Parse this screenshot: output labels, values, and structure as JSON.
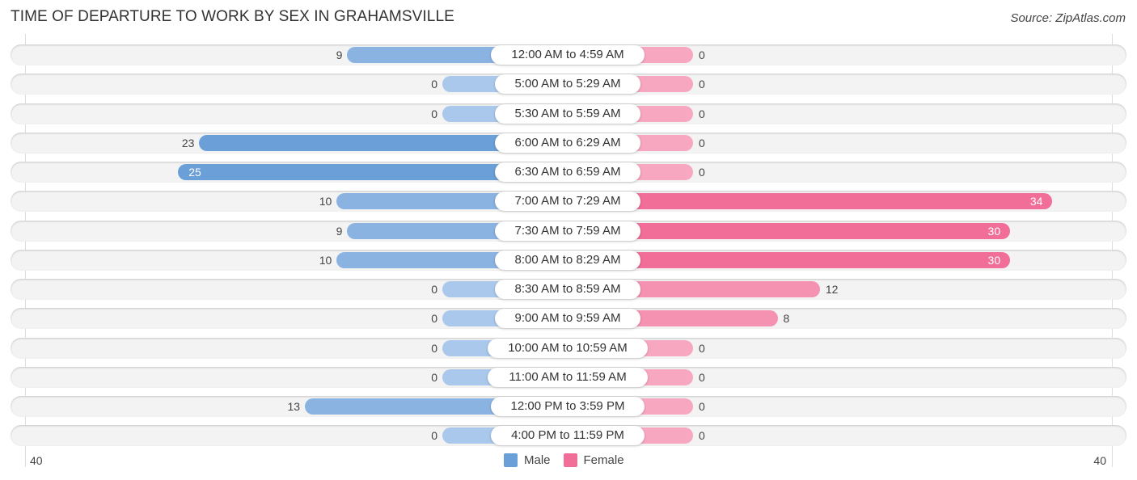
{
  "header": {
    "title": "TIME OF DEPARTURE TO WORK BY SEX IN GRAHAMSVILLE",
    "source": "Source: ZipAtlas.com"
  },
  "colors": {
    "male_strong": "#6a9fd8",
    "male_light": "#a9c8ec",
    "female_strong": "#f06e98",
    "female_light": "#f7a8c0"
  },
  "chart_data": {
    "type": "bar",
    "orientation": "horizontal-diverging",
    "title": "TIME OF DEPARTURE TO WORK BY SEX IN GRAHAMSVILLE",
    "categories": [
      "12:00 AM to 4:59 AM",
      "5:00 AM to 5:29 AM",
      "5:30 AM to 5:59 AM",
      "6:00 AM to 6:29 AM",
      "6:30 AM to 6:59 AM",
      "7:00 AM to 7:29 AM",
      "7:30 AM to 7:59 AM",
      "8:00 AM to 8:29 AM",
      "8:30 AM to 8:59 AM",
      "9:00 AM to 9:59 AM",
      "10:00 AM to 10:59 AM",
      "11:00 AM to 11:59 AM",
      "12:00 PM to 3:59 PM",
      "4:00 PM to 11:59 PM"
    ],
    "series": [
      {
        "name": "Male",
        "values": [
          9,
          0,
          0,
          23,
          25,
          10,
          9,
          10,
          0,
          0,
          0,
          0,
          13,
          0
        ]
      },
      {
        "name": "Female",
        "values": [
          0,
          0,
          0,
          0,
          0,
          34,
          30,
          30,
          12,
          8,
          0,
          0,
          0,
          0
        ]
      }
    ],
    "axis": {
      "left_label": "40",
      "right_label": "40",
      "range": [
        -40,
        40
      ]
    },
    "legend": {
      "position": "bottom-center",
      "entries": [
        "Male",
        "Female"
      ]
    },
    "xlabel": "",
    "ylabel": ""
  }
}
